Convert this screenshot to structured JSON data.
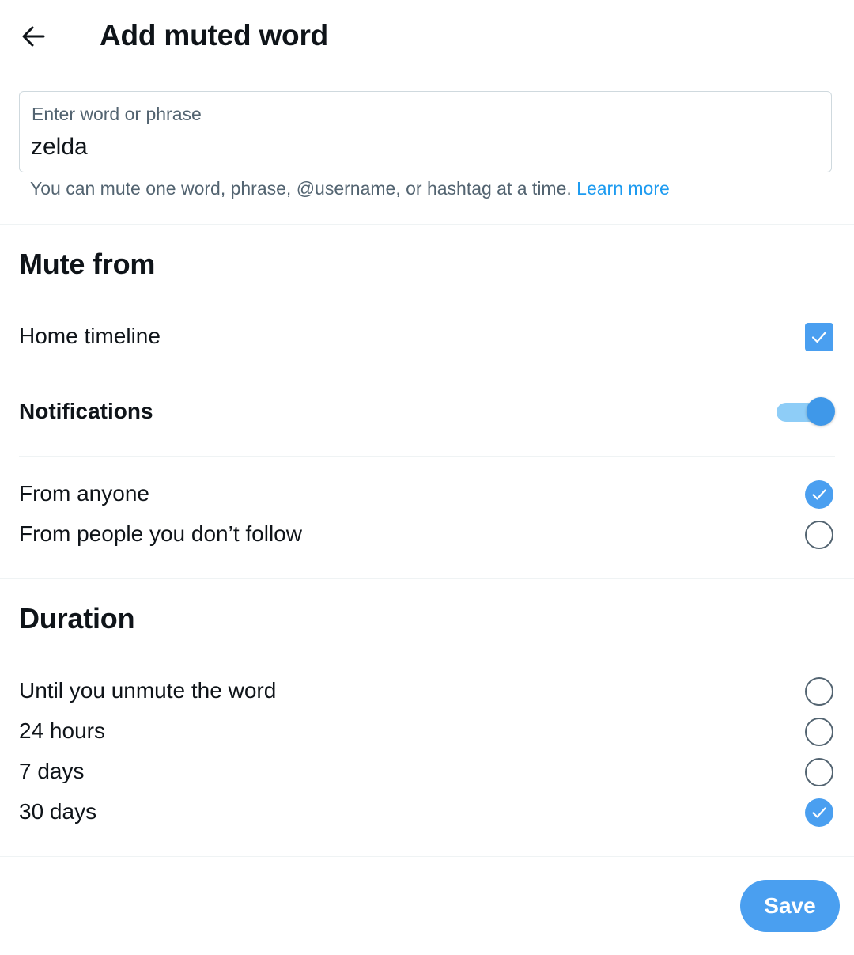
{
  "header": {
    "title": "Add muted word",
    "back_icon": "arrow-left-icon"
  },
  "word_field": {
    "label": "Enter word or phrase",
    "value": "zelda",
    "helper_text": "You can mute one word, phrase, @username, or hashtag at a time.",
    "learn_more": "Learn more"
  },
  "mute_from": {
    "title": "Mute from",
    "home_timeline": {
      "label": "Home timeline",
      "checked": true
    },
    "notifications": {
      "label": "Notifications",
      "enabled": true
    },
    "options": [
      {
        "label": "From anyone",
        "selected": true
      },
      {
        "label": "From people you don’t follow",
        "selected": false
      }
    ]
  },
  "duration": {
    "title": "Duration",
    "options": [
      {
        "label": "Until you unmute the word",
        "selected": false
      },
      {
        "label": "24 hours",
        "selected": false
      },
      {
        "label": "7 days",
        "selected": false
      },
      {
        "label": "30 days",
        "selected": true
      }
    ]
  },
  "actions": {
    "save_label": "Save"
  },
  "colors": {
    "accent": "#4a9ff0",
    "link": "#1d9bf0",
    "text": "#0f1419",
    "secondary_text": "#536471",
    "toggle_track": "#8ecdf7"
  }
}
